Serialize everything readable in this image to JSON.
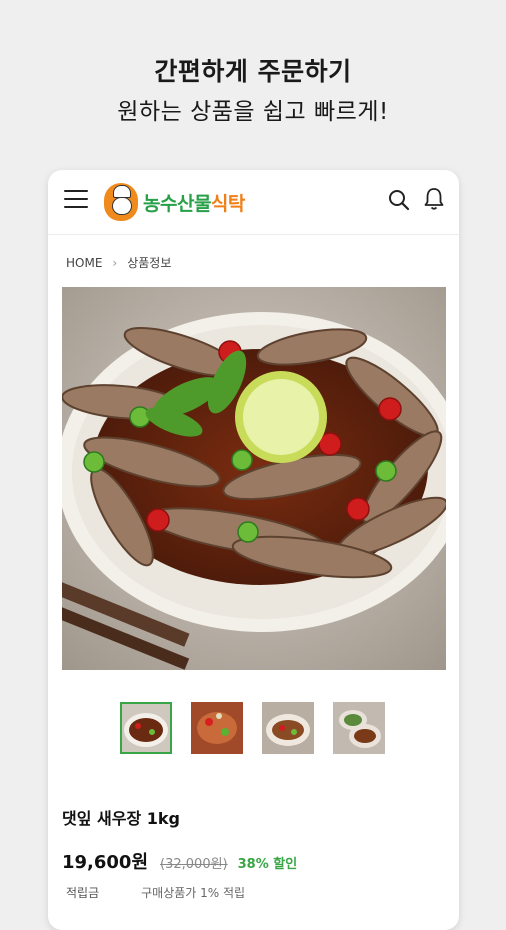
{
  "promo": {
    "headline": "간편하게 주문하기",
    "subline": "원하는 상품을 쉽고 빠르게!"
  },
  "app": {
    "logo_part1": "농수산물",
    "logo_part2": "식탁",
    "brand_green": "#27a048",
    "brand_orange": "#ef7f16",
    "icons": [
      "menu-icon",
      "search-icon",
      "bell-icon",
      "chevron-right-icon"
    ]
  },
  "breadcrumb": {
    "home": "HOME",
    "current": "상품정보"
  },
  "product": {
    "name": "댓잎 새우장 1kg",
    "price": "19,600원",
    "original_price": "(32,000원)",
    "discount": "38% 할인",
    "points_label": "적립금",
    "points_value": "구매상품가 1% 적립",
    "thumbnail_count": 4,
    "selected_thumbnail": 1
  }
}
